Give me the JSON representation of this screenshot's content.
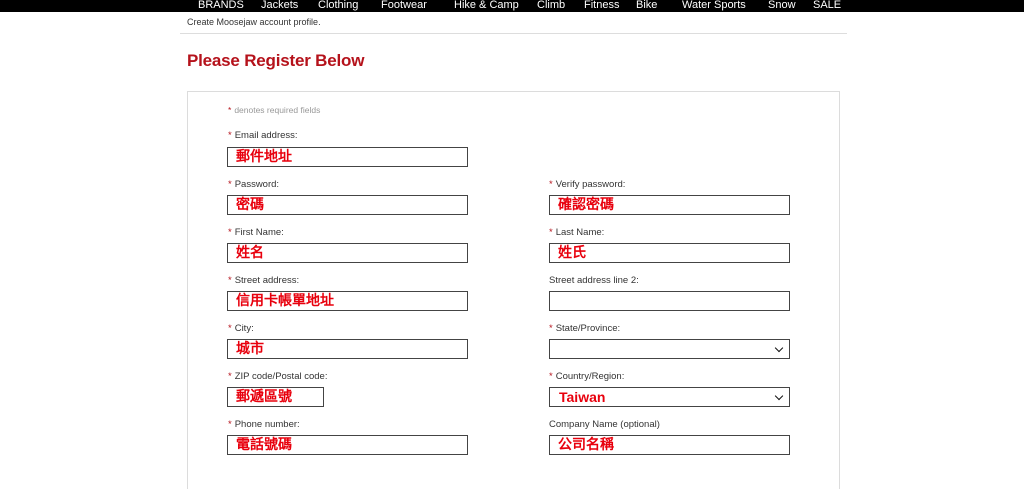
{
  "nav": {
    "items": [
      "BRANDS",
      "Jackets",
      "Clothing",
      "Footwear",
      "Hike & Camp",
      "Climb",
      "Fitness",
      "Bike",
      "Water Sports",
      "Snow",
      "SALE"
    ]
  },
  "breadcrumb": "Create Moosejaw account profile.",
  "page_title": "Please Register Below",
  "form": {
    "required_note_star": "*",
    "required_note": "denotes required fields",
    "email": {
      "star": "*",
      "label": "Email address:",
      "placeholder": "郵件地址"
    },
    "password": {
      "star": "*",
      "label": "Password:",
      "placeholder": "密碼"
    },
    "verify_password": {
      "star": "*",
      "label": "Verify password:",
      "placeholder": "確認密碼"
    },
    "first_name": {
      "star": "*",
      "label": "First Name:",
      "placeholder": "姓名"
    },
    "last_name": {
      "star": "*",
      "label": "Last Name:",
      "placeholder": "姓氏"
    },
    "street": {
      "star": "*",
      "label": "Street address:",
      "placeholder": "信用卡帳單地址"
    },
    "street2": {
      "label": "Street address line 2:",
      "value": ""
    },
    "city": {
      "star": "*",
      "label": "City:",
      "placeholder": "城市"
    },
    "state": {
      "star": "*",
      "label": "State/Province:",
      "selected": ""
    },
    "zip": {
      "star": "*",
      "label": "ZIP code/Postal code:",
      "placeholder": "郵遞區號"
    },
    "country": {
      "star": "*",
      "label": "Country/Region:",
      "selected": "Taiwan"
    },
    "phone": {
      "star": "*",
      "label": "Phone number:",
      "placeholder": "電話號碼"
    },
    "company": {
      "label": "Company Name (optional)",
      "placeholder": "公司名稱"
    }
  },
  "colors": {
    "brand_red": "#b5121b",
    "annotation_red": "#e8000d",
    "nav_bg": "#000000"
  }
}
